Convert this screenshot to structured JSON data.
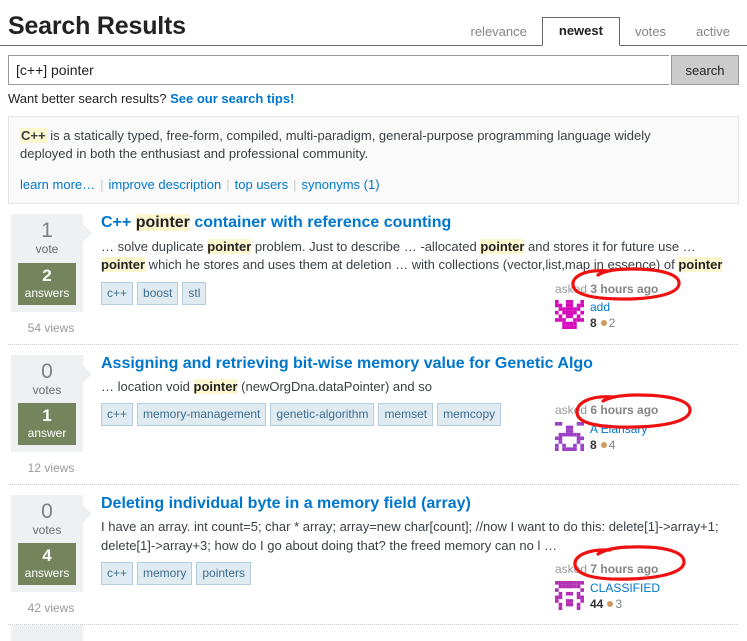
{
  "header": {
    "title": "Search Results",
    "tabs": [
      {
        "label": "relevance",
        "active": false
      },
      {
        "label": "newest",
        "active": true
      },
      {
        "label": "votes",
        "active": false
      },
      {
        "label": "active",
        "active": false
      }
    ]
  },
  "search": {
    "value": "[c++] pointer",
    "placeholder": "search",
    "button_label": "search",
    "tips_prefix": "Want better search results?",
    "tips_link": "See our search tips!"
  },
  "tagwiki": {
    "tag": "C++",
    "excerpt": " is a statically typed, free-form, compiled, multi-paradigm, general-purpose programming language widely deployed in both the enthusiast and professional community.",
    "links": [
      {
        "label": "learn more…"
      },
      {
        "label": "improve description"
      },
      {
        "label": "top users"
      },
      {
        "label": "synonyms (1)"
      }
    ]
  },
  "results": [
    {
      "votes": "1",
      "votes_label": "vote",
      "answers": "2",
      "answers_label": "answers",
      "views": "54 views",
      "title_parts": [
        {
          "text": "C++ ",
          "highlight": false
        },
        {
          "text": "pointer",
          "highlight": true
        },
        {
          "text": " container with reference counting",
          "highlight": false
        }
      ],
      "title_plain": "C++ pointer container with reference counting",
      "excerpt_parts": [
        {
          "text": "… solve duplicate ",
          "highlight": false
        },
        {
          "text": "pointer",
          "highlight": true
        },
        {
          "text": " problem. Just to describe … -allocated ",
          "highlight": false
        },
        {
          "text": "pointer",
          "highlight": true
        },
        {
          "text": " and stores it for future use … ",
          "highlight": false
        },
        {
          "text": "pointer",
          "highlight": true
        },
        {
          "text": " which he stores and uses them at deletion … with collections (vector,list,map in essence) of ",
          "highlight": false
        },
        {
          "text": "pointer",
          "highlight": true
        }
      ],
      "tags": [
        "c++",
        "boost",
        "stl"
      ],
      "action": "asked",
      "time": "3 hours ago",
      "user": "add",
      "reputation": "8",
      "bronze_badges": "2",
      "avatar_colors": [
        "#d40bbb",
        "#ffffff"
      ]
    },
    {
      "votes": "0",
      "votes_label": "votes",
      "answers": "1",
      "answers_label": "answer",
      "views": "12 views",
      "title_parts": [
        {
          "text": "Assigning and retrieving bit-wise memory value for Genetic Algo",
          "highlight": false
        }
      ],
      "title_plain": "Assigning and retrieving bit-wise memory value for Genetic Algo",
      "excerpt_parts": [
        {
          "text": "… location void ",
          "highlight": false
        },
        {
          "text": "pointer",
          "highlight": true
        },
        {
          "text": " (newOrgDna.dataPointer) and so",
          "highlight": false
        }
      ],
      "tags": [
        "c++",
        "memory-management",
        "genetic-algorithm",
        "memset",
        "memcopy"
      ],
      "action": "asked",
      "time": "6 hours ago",
      "user": "A Elansary",
      "reputation": "8",
      "bronze_badges": "4",
      "avatar_colors": [
        "#9b3fc4",
        "#ffffff"
      ]
    },
    {
      "votes": "0",
      "votes_label": "votes",
      "answers": "4",
      "answers_label": "answers",
      "views": "42 views",
      "title_parts": [
        {
          "text": "Deleting individual byte in a memory field (array)",
          "highlight": false
        }
      ],
      "title_plain": "Deleting individual byte in a memory field (array)",
      "excerpt_parts": [
        {
          "text": "I have an array. int count=5; char * array; array=new char[count]; //now I want to do this: delete[1]->array+1; delete[1]->array+3; how do I go about doing that? the freed memory can no l …",
          "highlight": false
        }
      ],
      "tags": [
        "c++",
        "memory",
        "pointers"
      ],
      "action": "asked",
      "time": "7 hours ago",
      "user": "CLASSIFIED",
      "reputation": "44",
      "bronze_badges": "3",
      "avatar_colors": [
        "#b32fb3",
        "#ffffff"
      ]
    }
  ],
  "annotations": [
    {
      "name": "circle-3-hours-ago",
      "color": "#ee1111"
    },
    {
      "name": "circle-6-hours-ago",
      "color": "#ee1111"
    },
    {
      "name": "circle-7-hours-ago",
      "color": "#ee1111"
    }
  ],
  "colors": {
    "link": "#0077cc",
    "answered_green": "#75845c",
    "highlight": "#fdf7d0",
    "tag_bg": "#e0eaf1",
    "tag_text": "#3e6d8e",
    "annotation_red": "#ee1111"
  }
}
